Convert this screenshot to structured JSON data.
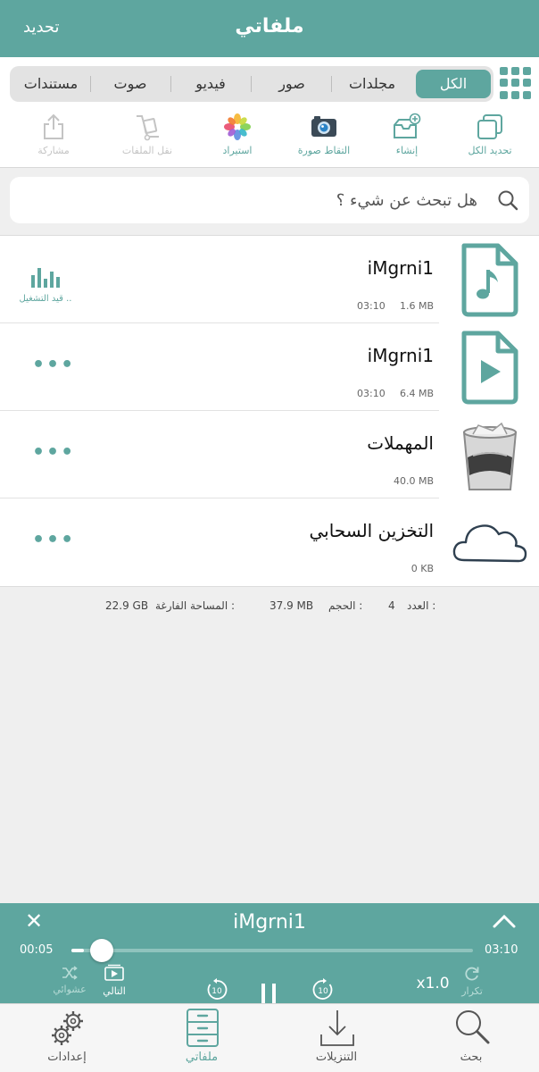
{
  "colors": {
    "accent": "#5ea69f",
    "disabled": "#c4c4c4"
  },
  "header": {
    "title": "ملفاتي",
    "edit_label": "تحديد"
  },
  "segments": [
    {
      "label": "الكل",
      "active": true
    },
    {
      "label": "مجلدات"
    },
    {
      "label": "صور"
    },
    {
      "label": "فيديو"
    },
    {
      "label": "صوت"
    },
    {
      "label": "مستندات"
    }
  ],
  "toolbar": [
    {
      "label": "تحديد الكل",
      "icon": "select-all-icon",
      "enabled": true
    },
    {
      "label": "إنشاء",
      "icon": "create-folder-icon",
      "enabled": true
    },
    {
      "label": "التقاط صورة",
      "icon": "camera-icon",
      "enabled": true
    },
    {
      "label": "استيراد",
      "icon": "photos-icon",
      "enabled": true
    },
    {
      "label": "نقل الملفات",
      "icon": "move-files-icon",
      "enabled": false
    },
    {
      "label": "مشاركة",
      "icon": "share-icon",
      "enabled": false
    }
  ],
  "search": {
    "placeholder": "هل تبحث عن شيء ؟",
    "icon": "search-icon"
  },
  "files": [
    {
      "name": "iMgrni1",
      "size": "1.6 MB",
      "time": "03:10",
      "icon": "audio-file-icon",
      "status": "قيد التشغيل .."
    },
    {
      "name": "iMgrni1",
      "size": "6.4 MB",
      "time": "03:10",
      "icon": "video-file-icon",
      "more": "•••"
    },
    {
      "name": "المهملات",
      "size": "40.0 MB",
      "icon": "trash-icon",
      "more": "•••"
    },
    {
      "name": "التخزين السحابي",
      "size": "0 KB",
      "icon": "cloud-icon",
      "more": "•••"
    }
  ],
  "summary": {
    "count_label": "العدد :",
    "count_value": "4",
    "size_label": "الحجم :",
    "size_value": "37.9 MB",
    "free_label": "المساحة الفارغة :",
    "free_value": "22.9 GB"
  },
  "player": {
    "title": "iMgrni1",
    "elapsed": "00:05",
    "total": "03:10",
    "progress": 0.03,
    "next_label": "التالي",
    "shuffle_label": "عشوائي",
    "repeat_label": "تكرار",
    "speed": "x1.0",
    "skip_seconds": "10"
  },
  "tabs": [
    {
      "label": "بحث",
      "icon": "search-icon"
    },
    {
      "label": "التنزيلات",
      "icon": "download-icon"
    },
    {
      "label": "ملفاتي",
      "icon": "cabinet-icon",
      "active": true
    },
    {
      "label": "إعدادات",
      "icon": "gears-icon"
    }
  ]
}
